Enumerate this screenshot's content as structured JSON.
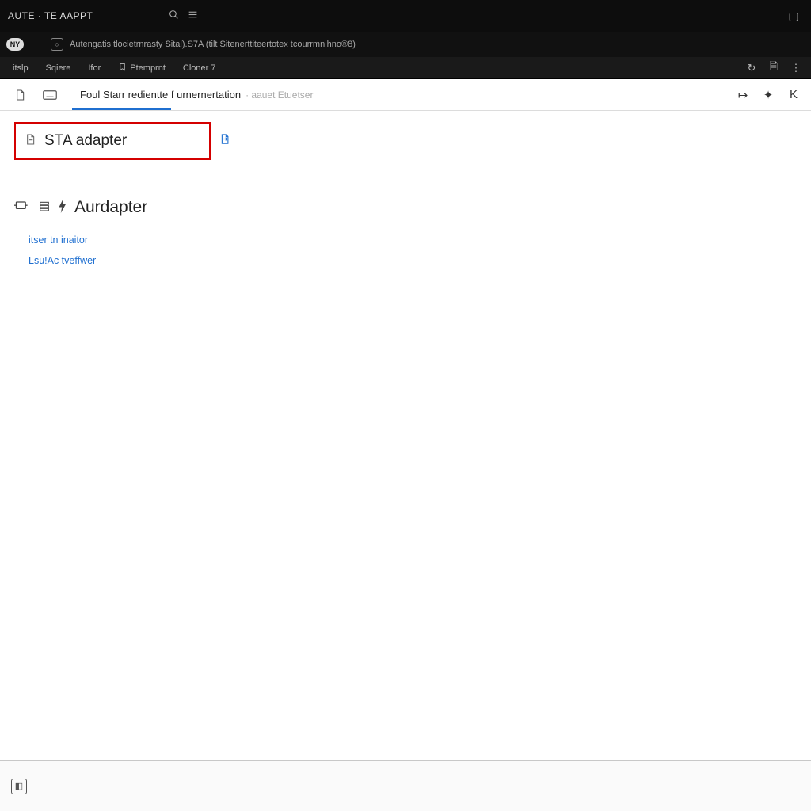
{
  "titlebar": {
    "title": "AUTE · TE AAPPT",
    "search_icon": "search",
    "menu_icon": "menu",
    "state_icon": "maximize"
  },
  "crumbbar": {
    "logo_text": "NY",
    "path": "Autengatis tlocietrnrasty Sital).S7A (tilt Sitenerttiteertotex tcourrmnihno®8)"
  },
  "menubar": {
    "items": [
      {
        "label": "itslp"
      },
      {
        "label": "Sqiere"
      },
      {
        "label": "Ifor"
      },
      {
        "label": "Ptemprnt",
        "icon": true
      },
      {
        "label": "Cloner   7"
      }
    ],
    "right_icons": [
      "sync",
      "doc",
      "more"
    ]
  },
  "tabstrip": {
    "left_icons": [
      "page",
      "keyboard"
    ],
    "tab_main": "Foul Starr redientte f urnernertation",
    "tab_sub": "· aauet Etuetser",
    "right_icons": [
      "export",
      "run",
      "close"
    ]
  },
  "search": {
    "value": "STA adapter"
  },
  "heading": "Aurdapter",
  "links": [
    "itser tn inaitor",
    "Lsu!Ac tveffwer"
  ]
}
